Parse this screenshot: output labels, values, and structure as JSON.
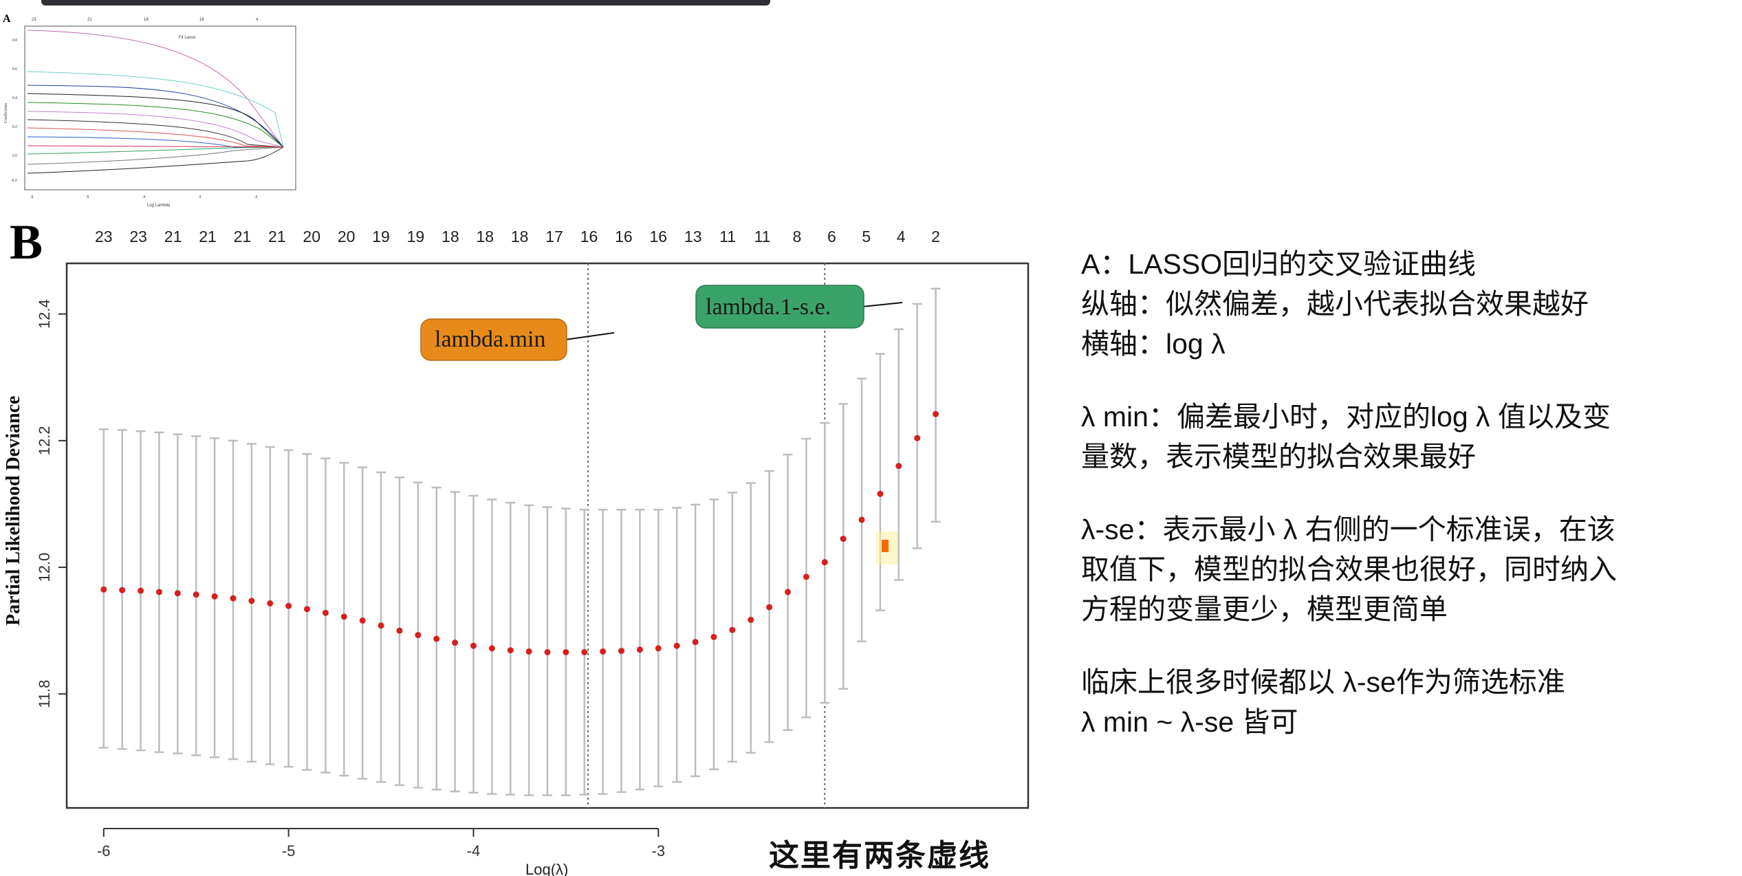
{
  "panel_a": {
    "letter": "A",
    "title": "Fit Lasso",
    "ylabel": "Coefficients",
    "xlabel": "Log Lambda",
    "top_counts": [
      "23",
      "21",
      "18",
      "16",
      "4"
    ],
    "x_ticks": [
      "-6",
      "-5",
      "-4",
      "-3",
      "-2"
    ],
    "y_ticks": [
      "0.8",
      "0.6",
      "0.4",
      "0.2",
      "0.0",
      "-0.2"
    ]
  },
  "chart_data": {
    "type": "scatter",
    "panel_letter": "B",
    "xlabel": "Log(λ)",
    "ylabel": "Partial Likelihood Deviance",
    "xlim": [
      -6.2,
      -1.0
    ],
    "ylim": [
      11.62,
      12.48
    ],
    "x_ticks": [
      -6,
      -5,
      -4,
      -3
    ],
    "y_ticks": [
      11.8,
      12.0,
      12.2,
      12.4
    ],
    "top_counts": [
      "23",
      "23",
      "21",
      "21",
      "21",
      "21",
      "20",
      "20",
      "19",
      "19",
      "18",
      "18",
      "18",
      "17",
      "16",
      "16",
      "16",
      "13",
      "11",
      "11",
      "8",
      "6",
      "5",
      "4",
      "2"
    ],
    "vlines": {
      "lambda_min": -3.38,
      "lambda_1se": -2.1
    },
    "annotations": [
      {
        "text": "lambda.min",
        "color": "#e88a1a"
      },
      {
        "text": "lambda.1-s.e.",
        "color": "#3aa36a"
      }
    ],
    "x": [
      -6.0,
      -5.9,
      -5.8,
      -5.7,
      -5.6,
      -5.5,
      -5.4,
      -5.3,
      -5.2,
      -5.1,
      -5.0,
      -4.9,
      -4.8,
      -4.7,
      -4.6,
      -4.5,
      -4.4,
      -4.3,
      -4.2,
      -4.1,
      -4.0,
      -3.9,
      -3.8,
      -3.7,
      -3.6,
      -3.5,
      -3.4,
      -3.3,
      -3.2,
      -3.1,
      -3.0,
      -2.9,
      -2.8,
      -2.7,
      -2.6,
      -2.5,
      -2.4,
      -2.3,
      -2.2,
      -2.1,
      -2.0,
      -1.9,
      -1.8,
      -1.7,
      -1.6,
      -1.5
    ],
    "y": [
      11.965,
      11.964,
      11.963,
      11.961,
      11.959,
      11.957,
      11.954,
      11.951,
      11.947,
      11.943,
      11.939,
      11.934,
      11.928,
      11.922,
      11.916,
      11.908,
      11.9,
      11.893,
      11.887,
      11.881,
      11.876,
      11.872,
      11.869,
      11.867,
      11.866,
      11.866,
      11.866,
      11.867,
      11.868,
      11.87,
      11.872,
      11.876,
      11.882,
      11.89,
      11.901,
      11.917,
      11.937,
      11.961,
      11.985,
      12.008,
      12.045,
      12.075,
      12.116,
      12.16,
      12.204,
      12.242
    ],
    "err_low": [
      11.715,
      11.713,
      11.711,
      11.708,
      11.706,
      11.703,
      11.7,
      11.697,
      11.693,
      11.689,
      11.685,
      11.68,
      11.676,
      11.671,
      11.666,
      11.661,
      11.656,
      11.652,
      11.649,
      11.646,
      11.644,
      11.642,
      11.641,
      11.64,
      11.64,
      11.64,
      11.641,
      11.642,
      11.645,
      11.649,
      11.654,
      11.661,
      11.67,
      11.681,
      11.693,
      11.707,
      11.724,
      11.743,
      11.763,
      11.786,
      11.808,
      11.883,
      11.932,
      11.98,
      12.03,
      12.072
    ],
    "err_high": [
      12.218,
      12.217,
      12.215,
      12.213,
      12.21,
      12.207,
      12.204,
      12.2,
      12.195,
      12.19,
      12.185,
      12.179,
      12.172,
      12.165,
      12.158,
      12.15,
      12.142,
      12.134,
      12.126,
      12.119,
      12.113,
      12.107,
      12.102,
      12.098,
      12.095,
      12.093,
      12.091,
      12.091,
      12.091,
      12.091,
      12.091,
      12.094,
      12.099,
      12.107,
      12.118,
      12.133,
      12.152,
      12.178,
      12.203,
      12.228,
      12.258,
      12.298,
      12.337,
      12.376,
      12.416,
      12.44
    ],
    "point_color": "#d62020",
    "errorbar_color": "#bdbdbd"
  },
  "notes": {
    "p1_l1": "A：LASSO回归的交叉验证曲线",
    "p1_l2": "纵轴：似然偏差，越小代表拟合效果越好",
    "p1_l3": "横轴：log λ",
    "p2_l1": "λ min：偏差最小时，对应的log λ 值以及变",
    "p2_l2": "量数，表示模型的拟合效果最好",
    "p3_l1": "λ-se：表示最小 λ 右侧的一个标准误，在该",
    "p3_l2": "取值下，模型的拟合效果也很好，同时纳入",
    "p3_l3": "方程的变量更少，模型更简单",
    "p4_l1": "临床上很多时候都以 λ-se作为筛选标准",
    "p4_l2": "λ min ~ λ-se 皆可"
  },
  "callout": "这里有两条虚线"
}
